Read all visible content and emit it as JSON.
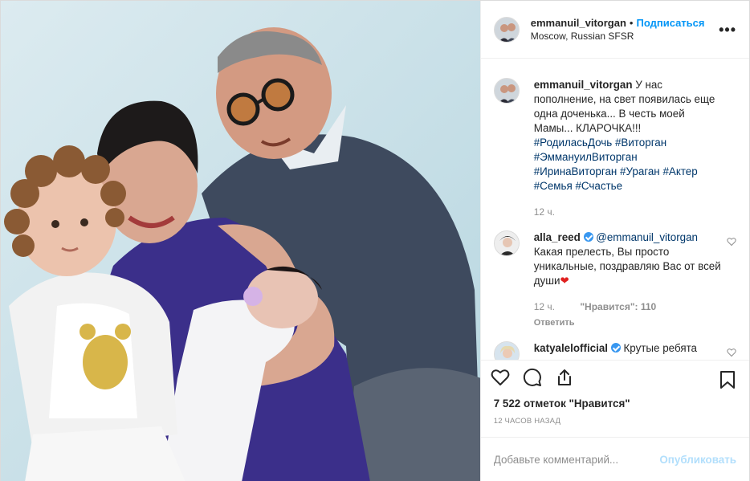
{
  "header": {
    "username": "emmanuil_vitorgan",
    "separator": "•",
    "follow_label": "Подписаться",
    "location": "Moscow, Russian SFSR",
    "more_label": "•••"
  },
  "caption": {
    "username": "emmanuil_vitorgan",
    "text": "У нас пополнение, на свет появилась еще одна доченька... В честь моей Мамы... КЛАРОЧКА!!!",
    "hashtags": [
      "#РодиласьДочь",
      "#Виторган",
      "#ЭммануилВиторган",
      "#ИринаВиторган",
      "#Ураган",
      "#Актер",
      "#Семья",
      "#Счастье"
    ],
    "time": "12 ч."
  },
  "comments": [
    {
      "username": "alla_reed",
      "verified": true,
      "mention": "@emmanuil_vitorgan",
      "text": "Какая прелесть, Вы просто уникальные, поздравляю Вас от всей души",
      "emoji": "❤",
      "time": "12 ч.",
      "likes": "\"Нравится\": 110",
      "reply_label": "Ответить"
    },
    {
      "username": "katyalelofficial",
      "verified": true,
      "text": "Крутые ребята"
    }
  ],
  "actions": {
    "icons": [
      "heart-icon",
      "comment-icon",
      "share-icon",
      "bookmark-icon"
    ],
    "likes_text": "7 522 отметок \"Нравится\"",
    "time_text": "12 часов назад"
  },
  "add_comment": {
    "placeholder": "Добавьте комментарий...",
    "publish_label": "Опубликовать"
  },
  "colors": {
    "accent": "#0095f6",
    "hashtag": "#00376b",
    "muted": "#8e8e8e",
    "publish_disabled": "#b2dffc",
    "verified": "#3897f0"
  }
}
